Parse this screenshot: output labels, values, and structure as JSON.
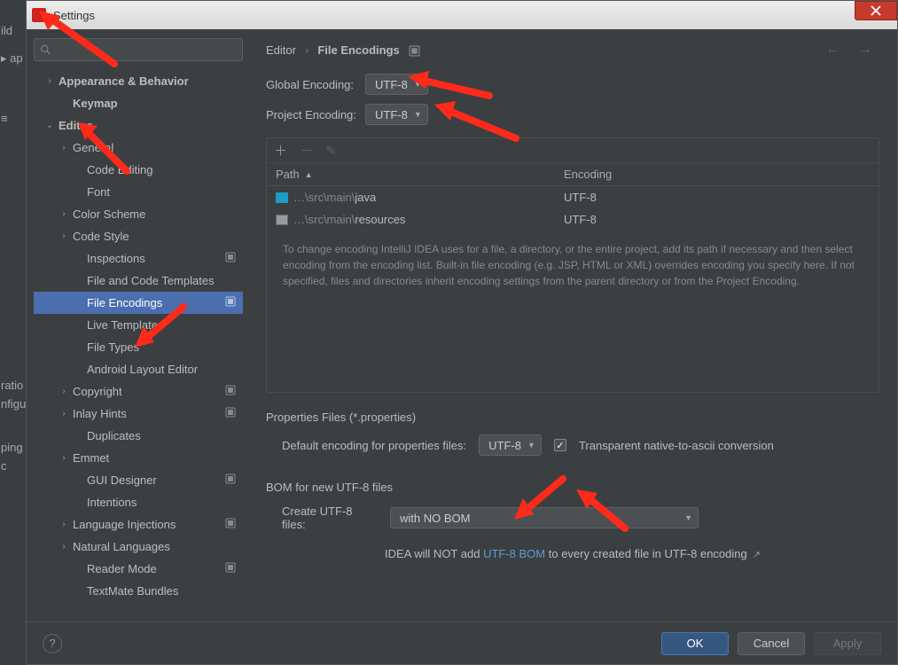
{
  "bg_fragments": [
    "ild",
    "ap",
    "ratio",
    "nfigu",
    "ping",
    "c"
  ],
  "window": {
    "title": "Settings"
  },
  "search": {
    "placeholder": ""
  },
  "tree": [
    {
      "label": "Appearance & Behavior",
      "indent": 12,
      "chev": "›",
      "bold": true
    },
    {
      "label": "Keymap",
      "indent": 28,
      "bold": true
    },
    {
      "label": "Editor",
      "indent": 12,
      "chev": "⌄",
      "bold": true
    },
    {
      "label": "General",
      "indent": 28,
      "chev": "›"
    },
    {
      "label": "Code Editing",
      "indent": 44
    },
    {
      "label": "Font",
      "indent": 44
    },
    {
      "label": "Color Scheme",
      "indent": 28,
      "chev": "›"
    },
    {
      "label": "Code Style",
      "indent": 28,
      "chev": "›"
    },
    {
      "label": "Inspections",
      "indent": 44,
      "badge": true
    },
    {
      "label": "File and Code Templates",
      "indent": 44
    },
    {
      "label": "File Encodings",
      "indent": 44,
      "selected": true,
      "badge": true
    },
    {
      "label": "Live Templates",
      "indent": 44
    },
    {
      "label": "File Types",
      "indent": 44
    },
    {
      "label": "Android Layout Editor",
      "indent": 44
    },
    {
      "label": "Copyright",
      "indent": 28,
      "chev": "›",
      "badge": true
    },
    {
      "label": "Inlay Hints",
      "indent": 28,
      "chev": "›",
      "badge": true
    },
    {
      "label": "Duplicates",
      "indent": 44
    },
    {
      "label": "Emmet",
      "indent": 28,
      "chev": "›"
    },
    {
      "label": "GUI Designer",
      "indent": 44,
      "badge": true
    },
    {
      "label": "Intentions",
      "indent": 44
    },
    {
      "label": "Language Injections",
      "indent": 28,
      "chev": "›",
      "badge": true
    },
    {
      "label": "Natural Languages",
      "indent": 28,
      "chev": "›"
    },
    {
      "label": "Reader Mode",
      "indent": 44,
      "badge": true
    },
    {
      "label": "TextMate Bundles",
      "indent": 44
    }
  ],
  "breadcrumb": {
    "root": "Editor",
    "current": "File Encodings"
  },
  "globalEncoding": {
    "label": "Global Encoding:",
    "value": "UTF-8"
  },
  "projectEncoding": {
    "label": "Project Encoding:",
    "value": "UTF-8"
  },
  "table": {
    "headers": {
      "path": "Path",
      "encoding": "Encoding"
    },
    "rows": [
      {
        "icon": "dir",
        "prefix": "…\\src\\main\\",
        "name": "java",
        "encoding": "UTF-8"
      },
      {
        "icon": "res",
        "prefix": "…\\src\\main\\",
        "name": "resources",
        "encoding": "UTF-8"
      }
    ]
  },
  "helpText": "To change encoding IntelliJ IDEA uses for a file, a directory, or the entire project, add its path if necessary and then select encoding from the encoding list. Built-in file encoding (e.g. JSP, HTML or XML) overrides encoding you specify here. If not specified, files and directories inherit encoding settings from the parent directory or from the Project Encoding.",
  "properties": {
    "sectionTitle": "Properties Files (*.properties)",
    "defaultLabel": "Default encoding for properties files:",
    "defaultValue": "UTF-8",
    "transparentLabel": "Transparent native-to-ascii conversion",
    "transparentChecked": true
  },
  "bom": {
    "sectionTitle": "BOM for new UTF-8 files",
    "createLabel": "Create UTF-8 files:",
    "createValue": "with NO BOM",
    "notePrefix": "IDEA will NOT add ",
    "noteLink": "UTF-8 BOM",
    "noteSuffix": " to every created file in UTF-8 encoding"
  },
  "buttons": {
    "ok": "OK",
    "cancel": "Cancel",
    "apply": "Apply"
  }
}
